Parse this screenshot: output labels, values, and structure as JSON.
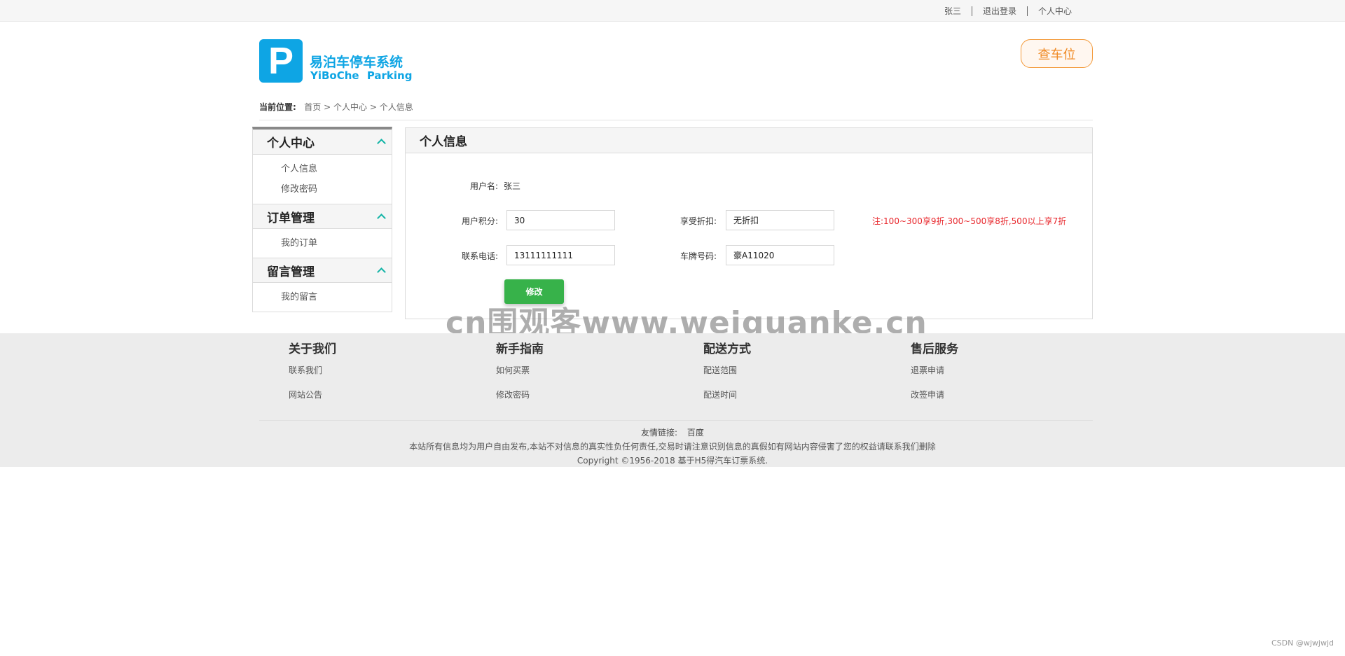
{
  "topbar": {
    "user": "张三",
    "logout": "退出登录",
    "profile": "个人中心"
  },
  "header": {
    "logo_letter": "P",
    "logo_cn": "易泊车停车系统",
    "logo_en": "YiBoChe Parking",
    "check_button": "查车位"
  },
  "breadcrumb": {
    "label": "当前位置:",
    "items": [
      "首页",
      "个人中心",
      "个人信息"
    ],
    "separator": ">"
  },
  "sidebar": {
    "groups": [
      {
        "title": "个人中心",
        "items": [
          "个人信息",
          "修改密码"
        ]
      },
      {
        "title": "订单管理",
        "items": [
          "我的订单"
        ]
      },
      {
        "title": "留言管理",
        "items": [
          "我的留言"
        ]
      }
    ]
  },
  "main": {
    "title": "个人信息",
    "username_label": "用户名:",
    "username_value": "张三",
    "points_label": "用户积分:",
    "points_value": "30",
    "discount_label": "享受折扣:",
    "discount_value": "无折扣",
    "note": "注:100~300享9折,300~500享8折,500以上享7折",
    "phone_label": "联系电话:",
    "phone_value": "13111111111",
    "plate_label": "车牌号码:",
    "plate_value": "豪A11020",
    "edit_button": "修改"
  },
  "watermark": "cn围观客www.weiguanke.cn",
  "footer": {
    "columns": [
      {
        "title": "关于我们",
        "links": [
          "联系我们",
          "网站公告"
        ]
      },
      {
        "title": "新手指南",
        "links": [
          "如何买票",
          "修改密码"
        ]
      },
      {
        "title": "配送方式",
        "links": [
          "配送范围",
          "配送时间"
        ]
      },
      {
        "title": "售后服务",
        "links": [
          "退票申请",
          "改签申请"
        ]
      }
    ],
    "friend_label": "友情链接:",
    "friend_link": "百度",
    "disclaimer": "本站所有信息均为用户自由发布,本站不对信息的真实性负任何责任,交易时请注意识别信息的真假如有网站内容侵害了您的权益请联系我们删除",
    "copyright": "Copyright ©1956-2018 基于H5得汽车订票系统."
  },
  "csdn_mark": "CSDN @wjwjwjd",
  "colors": {
    "brand_blue": "#0ea5e4",
    "accent_orange": "#f08a24",
    "button_green": "#37b24a",
    "note_red": "#e8262b"
  }
}
